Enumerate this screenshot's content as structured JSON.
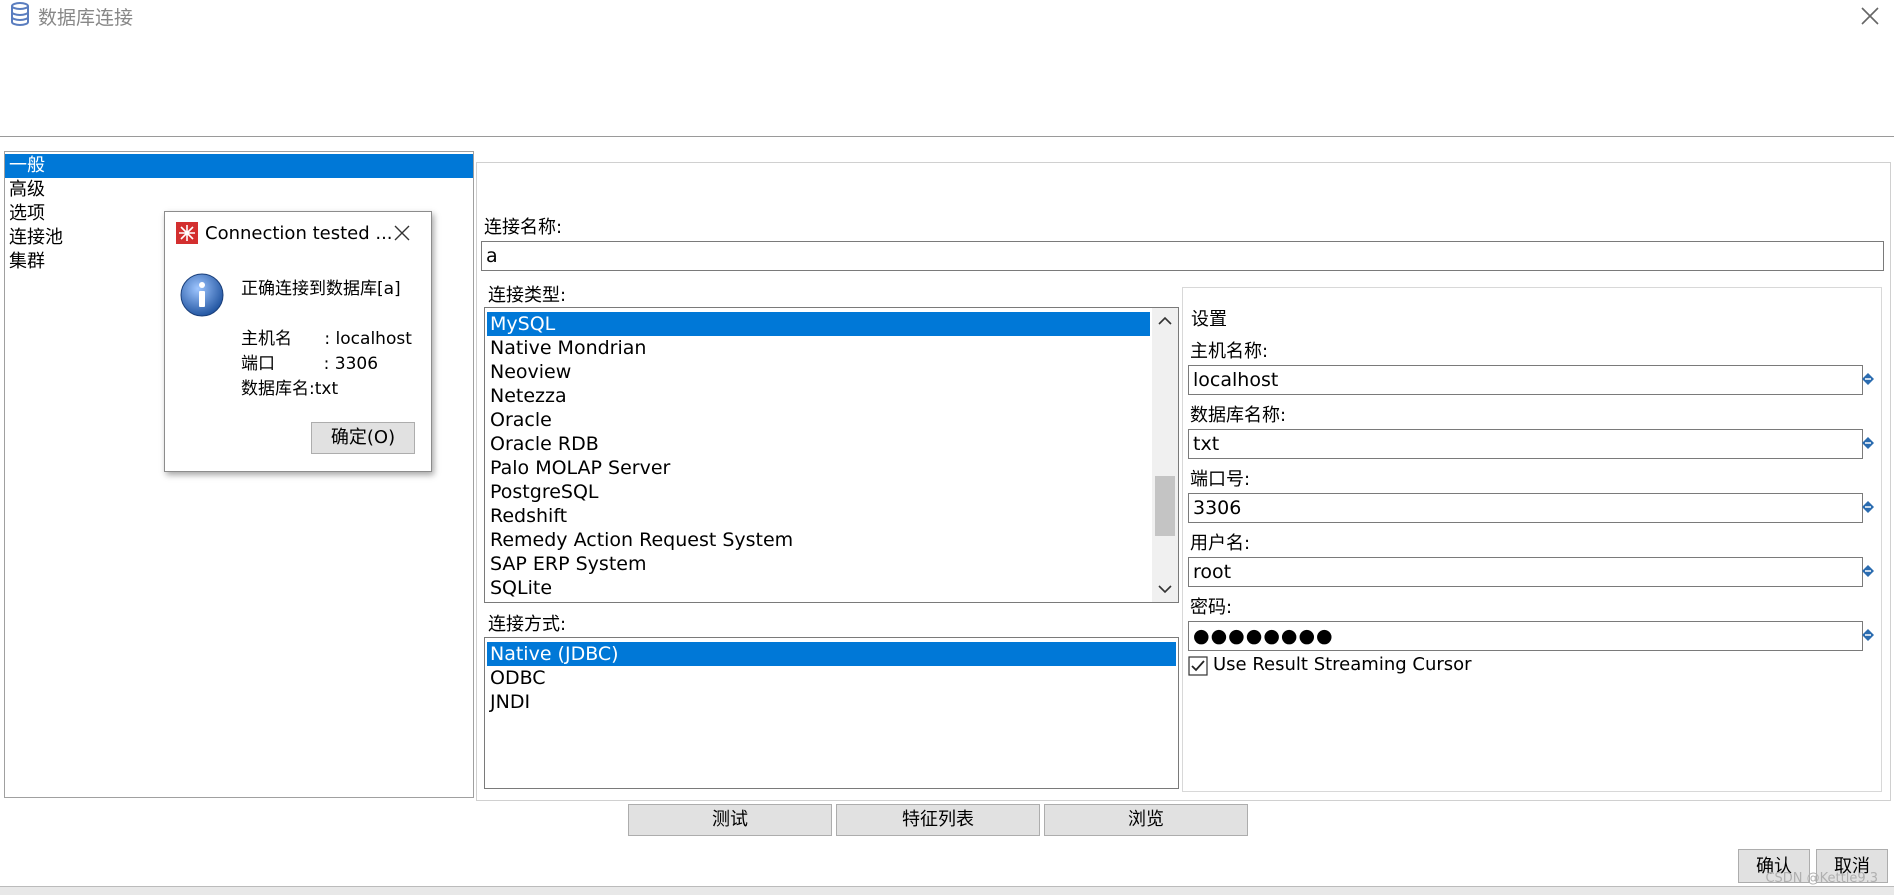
{
  "window": {
    "title": "数据库连接"
  },
  "nav": {
    "items": [
      "一般",
      "高级",
      "选项",
      "连接池",
      "集群"
    ],
    "selected_index": 0
  },
  "general": {
    "connection_name_label": "连接名称:",
    "connection_name_value": "a",
    "connection_type_label": "连接类型:",
    "connection_types": [
      "MySQL",
      "Native Mondrian",
      "Neoview",
      "Netezza",
      "Oracle",
      "Oracle RDB",
      "Palo MOLAP Server",
      "PostgreSQL",
      "Redshift",
      "Remedy Action Request System",
      "SAP ERP System",
      "SQLite"
    ],
    "connection_type_selected": "MySQL",
    "access_label": "连接方式:",
    "access_methods": [
      "Native (JDBC)",
      "ODBC",
      "JNDI"
    ],
    "access_selected": "Native (JDBC)"
  },
  "settings": {
    "title": "设置",
    "host_label": "主机名称:",
    "host_value": "localhost",
    "db_label": "数据库名称:",
    "db_value": "txt",
    "port_label": "端口号:",
    "port_value": "3306",
    "user_label": "用户名:",
    "user_value": "root",
    "password_label": "密码:",
    "password_value": "●●●●●●●●",
    "streaming_label": "Use Result Streaming Cursor",
    "streaming_checked": true
  },
  "buttons": {
    "test": "测试",
    "features": "特征列表",
    "explore": "浏览",
    "ok": "确认",
    "cancel": "取消"
  },
  "dialog": {
    "title": "Connection tested ...",
    "message": "正确连接到数据库[a]",
    "host_line": "主机名      : localhost",
    "port_line": "端口         : 3306",
    "db_line": "数据库名:txt",
    "ok_button": "确定(O)"
  },
  "watermark": "CSDN @Kettle9.3",
  "colors": {
    "selection": "#0078d7",
    "button_face": "#e1e1e1"
  }
}
